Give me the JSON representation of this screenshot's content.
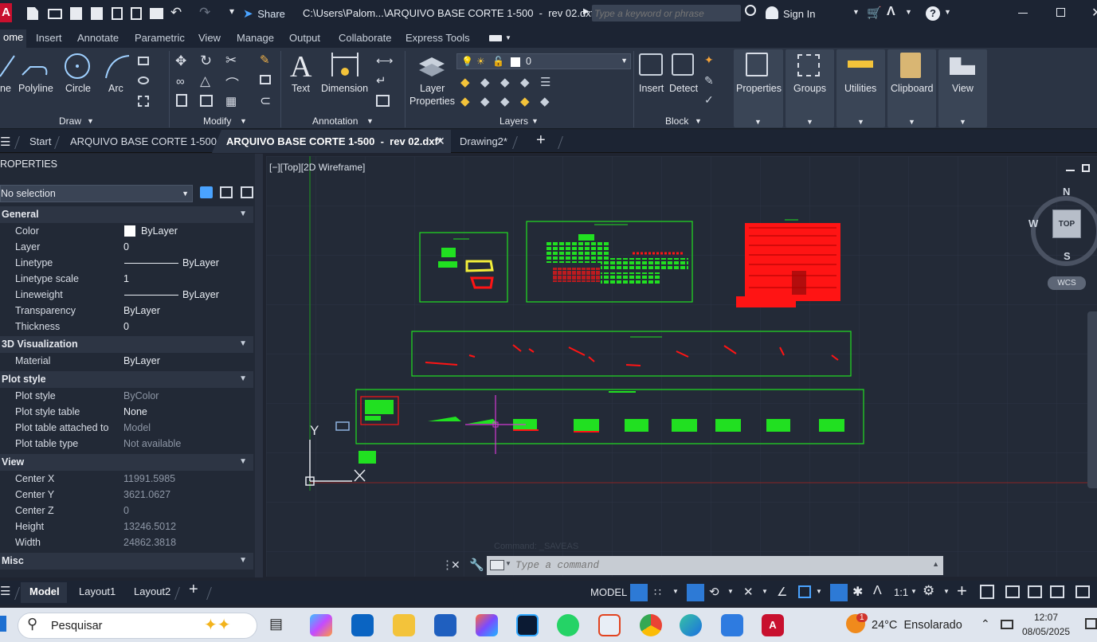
{
  "titlebar": {
    "app_letter": "A",
    "share_label": "Share",
    "file_path": "C:\\Users\\Palom...\\ARQUIVO BASE CORTE 1-500  -  rev 02.dxf",
    "search_placeholder": "Type a keyword or phrase",
    "sign_in": "Sign In"
  },
  "ribbon_tabs": [
    "ome",
    "Insert",
    "Annotate",
    "Parametric",
    "View",
    "Manage",
    "Output",
    "Collaborate",
    "Express Tools"
  ],
  "ribbon": {
    "draw": {
      "line": "ne",
      "polyline": "Polyline",
      "circle": "Circle",
      "arc": "Arc",
      "title": "Draw"
    },
    "modify": {
      "title": "Modify"
    },
    "annotation": {
      "text": "Text",
      "dimension": "Dimension",
      "title": "Annotation"
    },
    "layers": {
      "layer_properties_1": "Layer",
      "layer_properties_2": "Properties",
      "current_layer": "0",
      "title": "Layers"
    },
    "block": {
      "insert": "Insert",
      "detect": "Detect",
      "title": "Block"
    },
    "properties": "Properties",
    "groups": "Groups",
    "utilities": "Utilities",
    "clipboard": "Clipboard",
    "view": "View"
  },
  "doc_tabs": {
    "start": "Start",
    "tab1": "ARQUIVO BASE CORTE 1-500",
    "tab2": "ARQUIVO BASE CORTE 1-500  -  rev 02.dxf*",
    "tab3": "Drawing2*"
  },
  "properties_panel": {
    "title": "ROPERTIES",
    "selection": "No selection",
    "sections": {
      "general": "General",
      "viz3d": "3D Visualization",
      "plot": "Plot style",
      "view": "View",
      "misc": "Misc"
    },
    "general": [
      {
        "k": "Color",
        "v": "ByLayer"
      },
      {
        "k": "Layer",
        "v": "0"
      },
      {
        "k": "Linetype",
        "v": "ByLayer"
      },
      {
        "k": "Linetype scale",
        "v": "1"
      },
      {
        "k": "Lineweight",
        "v": "ByLayer"
      },
      {
        "k": "Transparency",
        "v": "ByLayer"
      },
      {
        "k": "Thickness",
        "v": "0"
      }
    ],
    "viz3d": [
      {
        "k": "Material",
        "v": "ByLayer"
      }
    ],
    "plot": [
      {
        "k": "Plot style",
        "v": "ByColor"
      },
      {
        "k": "Plot style table",
        "v": "None"
      },
      {
        "k": "Plot table attached to",
        "v": "Model"
      },
      {
        "k": "Plot table type",
        "v": "Not available"
      }
    ],
    "view": [
      {
        "k": "Center X",
        "v": "11991.5985"
      },
      {
        "k": "Center Y",
        "v": "3621.0627"
      },
      {
        "k": "Center Z",
        "v": "0"
      },
      {
        "k": "Height",
        "v": "13246.5012"
      },
      {
        "k": "Width",
        "v": "24862.3818"
      }
    ]
  },
  "viewport": {
    "label": "[−][Top][2D Wireframe]",
    "compass": {
      "n": "N",
      "s": "S",
      "w": "W",
      "top": "TOP",
      "wcs": "WCS"
    },
    "ucs_y": "Y"
  },
  "command": {
    "placeholder": "Type a command",
    "history": "Command: _SAVEAS"
  },
  "status_tabs": {
    "model": "Model",
    "layout1": "Layout1",
    "layout2": "Layout2"
  },
  "status": {
    "model": "MODEL",
    "scale": "1:1"
  },
  "taskbar": {
    "search": "Pesquisar",
    "weather": "24°C  Ensolarado",
    "time": "12:07",
    "date": "08/05/2025",
    "weather_badge": "1"
  },
  "colors": {
    "accent": "#2a7fd4",
    "cad_green": "#21e021",
    "cad_red": "#ff1414"
  }
}
